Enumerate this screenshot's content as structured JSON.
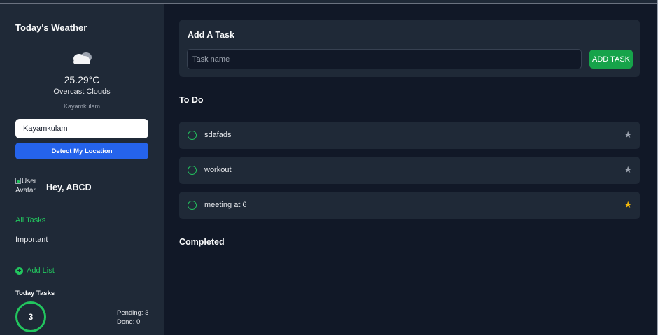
{
  "weather": {
    "title": "Today's Weather",
    "icon": "cloud-icon",
    "temperature": "25.29°C",
    "description": "Overcast Clouds",
    "city": "Kayamkulam",
    "city_input_value": "Kayamkulam",
    "detect_label": "Detect My Location"
  },
  "user": {
    "avatar_alt": "User Avatar",
    "greeting": "Hey, ABCD"
  },
  "nav": {
    "all_tasks": "All Tasks",
    "important": "Important",
    "add_list": "Add List"
  },
  "today": {
    "title": "Today Tasks",
    "count": "3",
    "pending": "Pending: 3",
    "done": "Done: 0"
  },
  "add_task": {
    "title": "Add A Task",
    "placeholder": "Task name",
    "button": "ADD TASK"
  },
  "todo": {
    "title": "To Do",
    "tasks": [
      {
        "name": "sdafads",
        "important": false
      },
      {
        "name": "workout",
        "important": false
      },
      {
        "name": "meeting at 6",
        "important": true
      }
    ]
  },
  "completed": {
    "title": "Completed"
  },
  "colors": {
    "accent_green": "#22c55e",
    "button_green": "#16a34a",
    "detect_blue": "#2563eb",
    "star_important": "#f5b90b",
    "sidebar_bg": "#1f2937",
    "main_bg": "#111827"
  }
}
